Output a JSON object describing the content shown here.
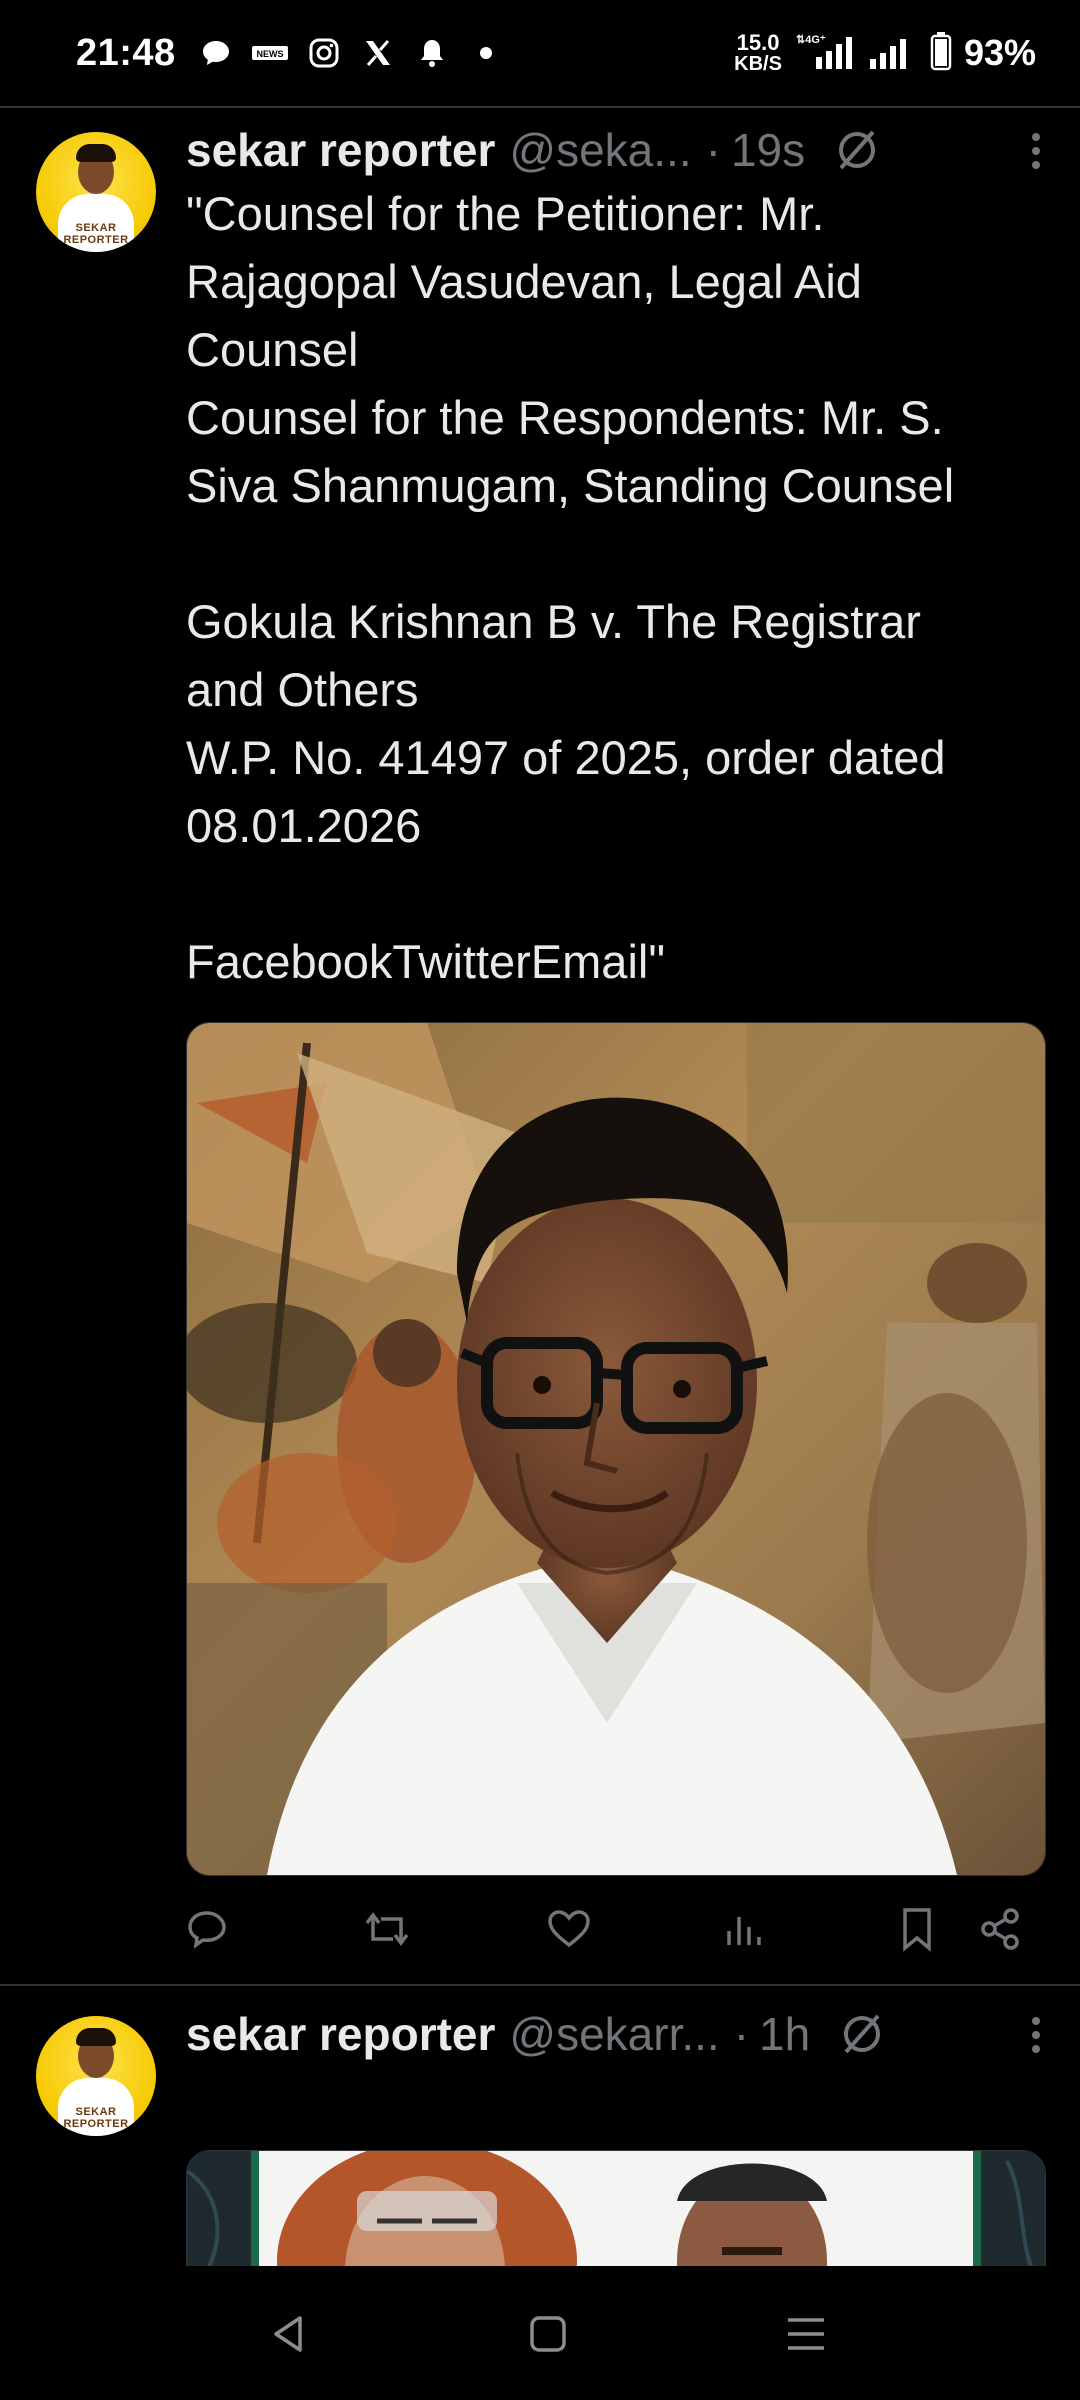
{
  "status_bar": {
    "time": "21:48",
    "icons": [
      "chat-bubble-icon",
      "news-icon",
      "instagram-icon",
      "x-icon",
      "bell-icon",
      "dot-icon"
    ],
    "net_speed_value": "15.0",
    "net_speed_unit": "KB/S",
    "network": "4G",
    "battery": "93%"
  },
  "tweets": [
    {
      "author": "sekar reporter",
      "handle": "@seka...",
      "time": "19s",
      "text": "\"Counsel for the Petitioner: Mr.\nRajagopal Vasudevan, Legal Aid\nCounsel\nCounsel for the Respondents: Mr. S.\nSiva Shanmugam, Standing Counsel\n\nGokula Krishnan B v. The Registrar\nand Others\nW.P. No. 41497 of 2025, order dated\n08.01.2026\n\nFacebookTwitterEmail\"",
      "avatar_label": "SEKAR REPORTER"
    },
    {
      "author": "sekar reporter",
      "handle": "@sekarr...",
      "time": "1h",
      "avatar_label": "SEKAR REPORTER"
    }
  ],
  "actions": [
    "reply-icon",
    "retweet-icon",
    "like-icon",
    "views-icon",
    "bookmark-icon",
    "share-icon"
  ],
  "colors": {
    "background": "#000000",
    "text": "#e7e9ea",
    "secondary": "#71767b",
    "divider": "#2f3336"
  },
  "nav": [
    "back-icon",
    "home-icon",
    "recents-icon"
  ]
}
